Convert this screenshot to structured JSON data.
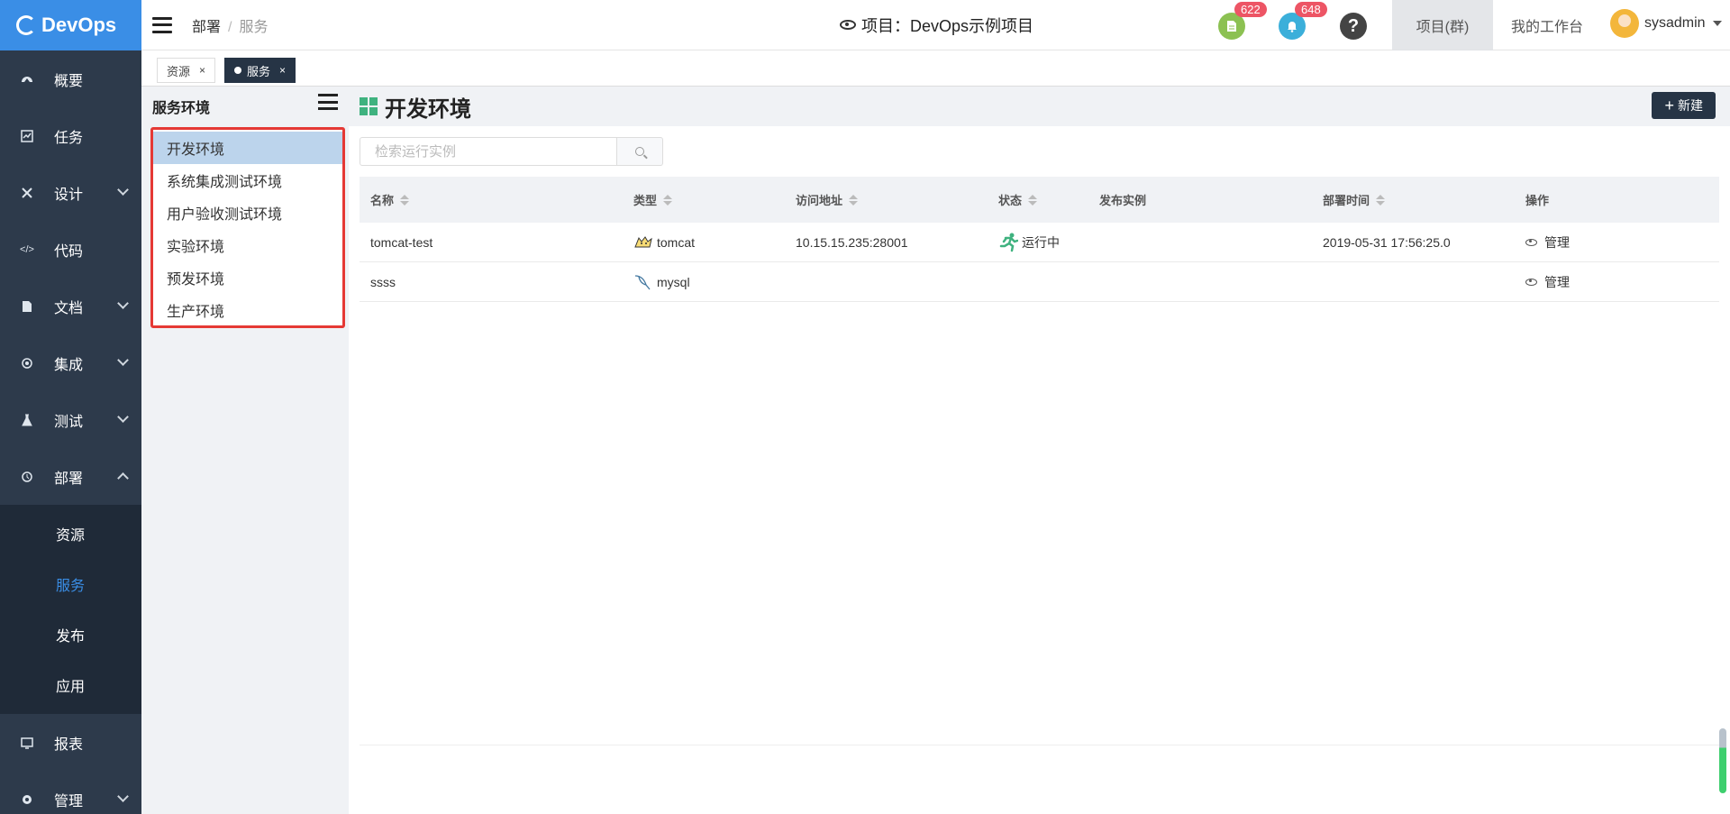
{
  "app": {
    "logo_text": "DevOps"
  },
  "sidebar": {
    "items": [
      {
        "label": "概要",
        "icon": "dashboard-icon"
      },
      {
        "label": "任务",
        "icon": "task-icon"
      },
      {
        "label": "设计",
        "icon": "design-icon",
        "expandable": true
      },
      {
        "label": "代码",
        "icon": "code-icon"
      },
      {
        "label": "文档",
        "icon": "document-icon",
        "expandable": true
      },
      {
        "label": "集成",
        "icon": "integration-icon",
        "expandable": true
      },
      {
        "label": "测试",
        "icon": "flask-icon",
        "expandable": true
      },
      {
        "label": "部署",
        "icon": "deploy-icon",
        "expanded": true
      }
    ],
    "sub_items": [
      {
        "label": "资源"
      },
      {
        "label": "服务",
        "active": true
      },
      {
        "label": "发布"
      },
      {
        "label": "应用"
      }
    ],
    "bottom_items": [
      {
        "label": "报表",
        "icon": "report-icon"
      },
      {
        "label": "管理",
        "icon": "settings-icon",
        "expandable": true
      }
    ]
  },
  "header": {
    "breadcrumb": [
      "部署",
      "服务"
    ],
    "project_label": "项目：DevOps示例项目",
    "badge_docs": "622",
    "badge_notify": "648",
    "help_glyph": "?",
    "tab_project_group": "项目(群)",
    "tab_workspace": "我的工作台",
    "username": "sysadmin"
  },
  "tabs": [
    {
      "label": "资源",
      "close": "×"
    },
    {
      "label": "服务",
      "close": "×",
      "active": true
    }
  ],
  "env_panel": {
    "title": "服务环境",
    "items": [
      "开发环境",
      "系统集成测试环境",
      "用户验收测试环境",
      "实验环境",
      "预发环境",
      "生产环境"
    ],
    "active_index": 0
  },
  "main": {
    "title": "开发环境",
    "new_button": "新建",
    "new_plus": "+",
    "search_placeholder": "检索运行实例",
    "columns": [
      "名称",
      "类型",
      "访问地址",
      "状态",
      "发布实例",
      "部署时间",
      "操作"
    ],
    "rows": [
      {
        "name": "tomcat-test",
        "type": "tomcat",
        "address": "10.15.15.235:28001",
        "status": "运行中",
        "release": "",
        "deploy_time": "2019-05-31 17:56:25.0",
        "action": "管理"
      },
      {
        "name": "ssss",
        "type": "mysql",
        "address": "",
        "status": "",
        "release": "",
        "deploy_time": "",
        "action": "管理"
      }
    ]
  },
  "colors": {
    "sidebar_bg": "#2d3a4b",
    "logo_bg": "#3a8ee6",
    "accent": "#3a8ee6",
    "status_running": "#3fb27f",
    "highlight_border": "#e53935",
    "badge": "#ed5565"
  }
}
